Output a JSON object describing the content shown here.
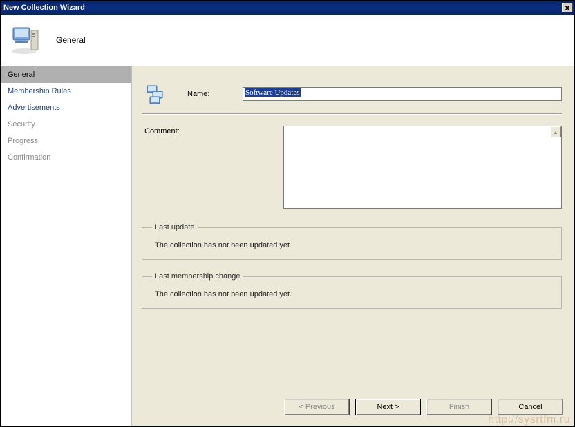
{
  "window": {
    "title": "New Collection Wizard"
  },
  "header": {
    "title": "General"
  },
  "sidebar": {
    "items": [
      {
        "label": "General",
        "state": "active"
      },
      {
        "label": "Membership Rules",
        "state": "link"
      },
      {
        "label": "Advertisements",
        "state": "link"
      },
      {
        "label": "Security",
        "state": "disabled"
      },
      {
        "label": "Progress",
        "state": "disabled"
      },
      {
        "label": "Confirmation",
        "state": "disabled"
      }
    ]
  },
  "form": {
    "name_label": "Name:",
    "name_value": "Software Updates",
    "comment_label": "Comment:",
    "last_update": {
      "legend": "Last update",
      "text": "The collection has not been updated yet."
    },
    "last_membership": {
      "legend": "Last membership change",
      "text": "The collection has not been updated yet."
    }
  },
  "buttons": {
    "previous": "< Previous",
    "next": "Next >",
    "finish": "Finish",
    "cancel": "Cancel"
  },
  "watermark": "http://sysrtfm.ru"
}
